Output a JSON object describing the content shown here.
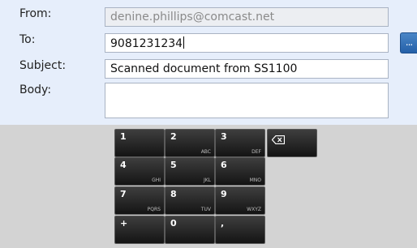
{
  "form": {
    "from_label": "From:",
    "from_value": "denine.phillips@comcast.net",
    "to_label": "To:",
    "to_value": "9081231234",
    "subject_label": "Subject:",
    "subject_value": "Scanned document from SS1100",
    "body_label": "Body:",
    "body_value": "",
    "contacts_button": "..."
  },
  "keypad": {
    "keys": [
      {
        "num": "1",
        "letters": ""
      },
      {
        "num": "2",
        "letters": "ABC"
      },
      {
        "num": "3",
        "letters": "DEF"
      },
      {
        "num": "4",
        "letters": "GHI"
      },
      {
        "num": "5",
        "letters": "JKL"
      },
      {
        "num": "6",
        "letters": "MNO"
      },
      {
        "num": "7",
        "letters": "PQRS"
      },
      {
        "num": "8",
        "letters": "TUV"
      },
      {
        "num": "9",
        "letters": "WXYZ"
      },
      {
        "num": "+",
        "letters": ""
      },
      {
        "num": "0",
        "letters": ""
      },
      {
        "num": ",",
        "letters": ""
      }
    ],
    "backspace_icon": "backspace-icon"
  }
}
